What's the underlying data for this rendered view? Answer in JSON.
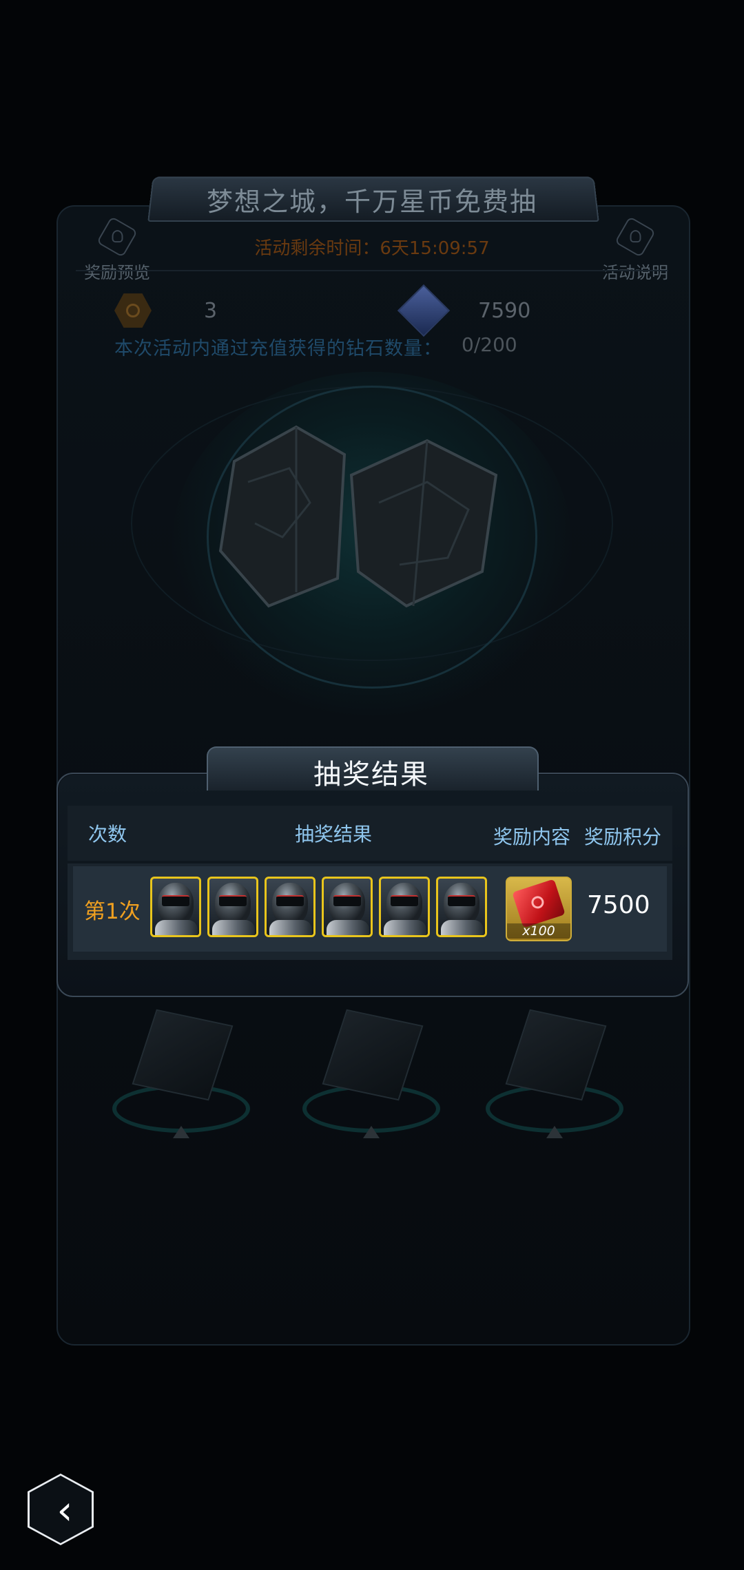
{
  "event": {
    "title": "梦想之城，千万星币免费抽",
    "timer_text": "活动剩余时间：6天15:09:57",
    "reward_preview_label": "奖励预览",
    "rules_label": "活动说明",
    "count_value": "3",
    "diamond_value": "7590",
    "recharge_label": "本次活动内通过充值获得的钻石数量：",
    "recharge_value": "0/200"
  },
  "result_dialog": {
    "title": "抽奖结果",
    "headers": {
      "count": "次数",
      "result": "抽奖结果",
      "reward": "奖励内容",
      "points": "奖励积分"
    },
    "rows": [
      {
        "label": "第1次",
        "result_items": [
          "helmet-avatar-icon",
          "helmet-avatar-icon",
          "helmet-avatar-icon",
          "helmet-avatar-icon",
          "helmet-avatar-icon",
          "helmet-avatar-icon"
        ],
        "reward_qty": "x100",
        "points": "7500"
      }
    ]
  },
  "back_button": {
    "icon": "chevron-left-icon",
    "glyph": "‹"
  },
  "colors": {
    "accent_orange": "#f0a020",
    "header_blue": "#8fc6ee",
    "slot_border": "#e9c51c"
  }
}
